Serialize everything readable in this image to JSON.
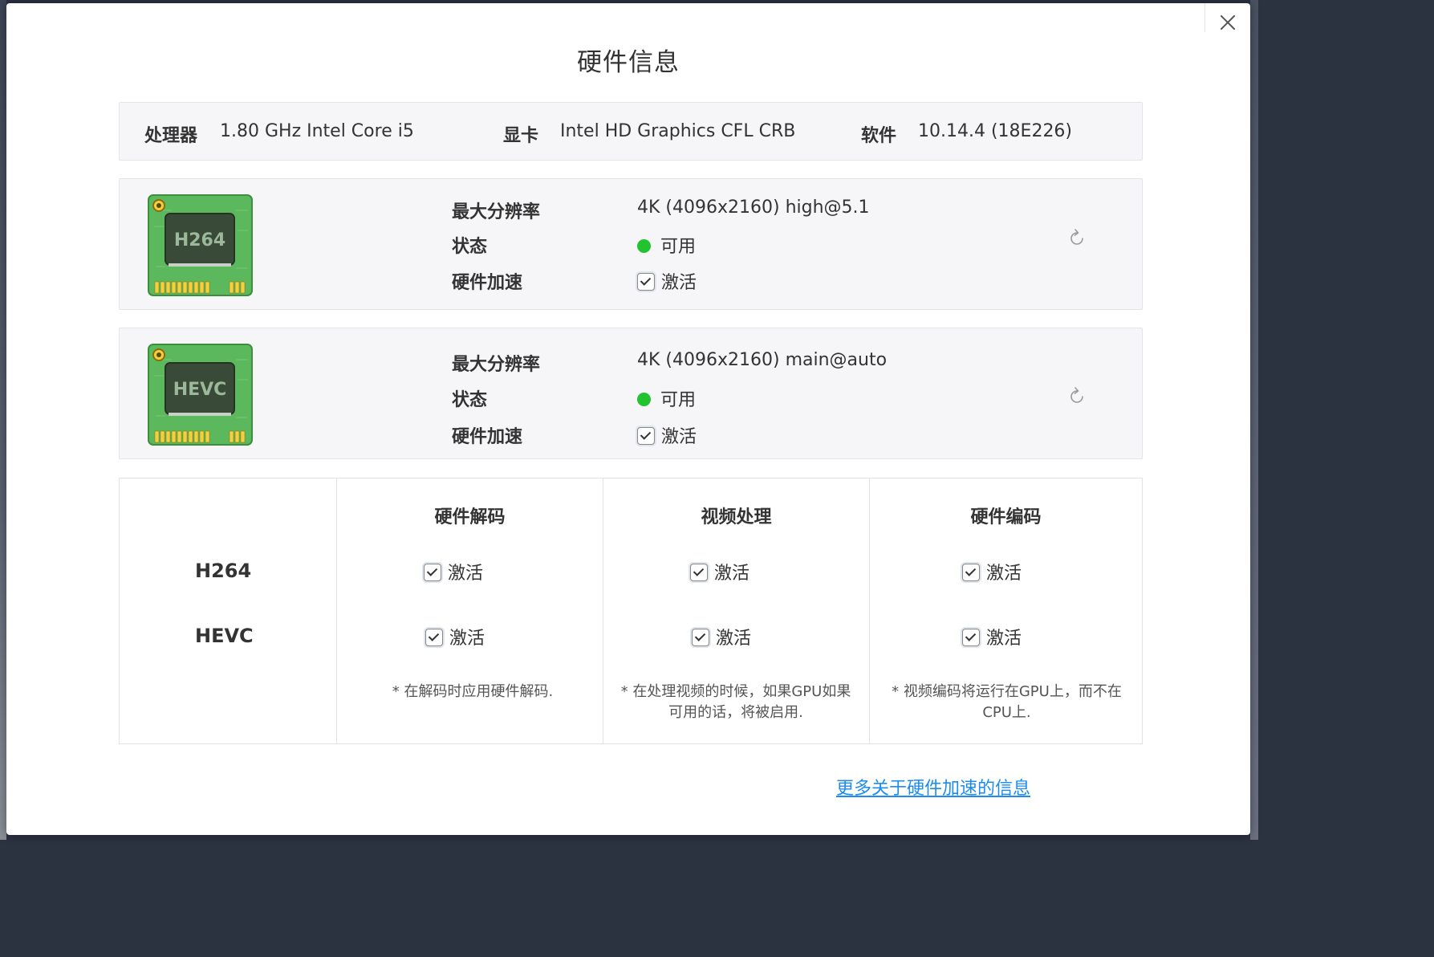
{
  "dialog": {
    "title": "硬件信息",
    "close_label": "close"
  },
  "system": {
    "cpu_label": "处理器",
    "cpu_value": "1.80 GHz Intel Core i5",
    "gpu_label": "显卡",
    "gpu_value": "Intel HD Graphics CFL CRB",
    "software_label": "软件",
    "software_value": "10.14.4 (18E226)"
  },
  "codecs": [
    {
      "chip_text": "H264",
      "max_res_label": "最大分辨率",
      "max_res_value": "4K (4096x2160) high@5.1",
      "status_label": "状态",
      "status_value": "可用",
      "hw_accel_label": "硬件加速",
      "hw_accel_value": "激活",
      "hw_accel_checked": true,
      "icon": "refresh-icon"
    },
    {
      "chip_text": "HEVC",
      "max_res_label": "最大分辨率",
      "max_res_value": "4K (4096x2160) main@auto",
      "status_label": "状态",
      "status_value": "可用",
      "hw_accel_label": "硬件加速",
      "hw_accel_value": "激活",
      "hw_accel_checked": true,
      "icon": "refresh-icon"
    }
  ],
  "matrix": {
    "columns": [
      "硬件解码",
      "视频处理",
      "硬件编码"
    ],
    "rows": [
      {
        "name": "H264",
        "cells": [
          "激活",
          "激活",
          "激活"
        ]
      },
      {
        "name": "HEVC",
        "cells": [
          "激活",
          "激活",
          "激活"
        ]
      }
    ],
    "notes": [
      "* 在解码时应用硬件解码.",
      "* 在处理视频的时候，如果GPU如果可用的话，将被启用.",
      "* 视频编码将运行在GPU上，而不在CPU上."
    ]
  },
  "more_link": "更多关于硬件加速的信息",
  "colors": {
    "status_ok": "#22c32e",
    "link": "#1d8cf0",
    "chip_green": "#5cb85c"
  }
}
